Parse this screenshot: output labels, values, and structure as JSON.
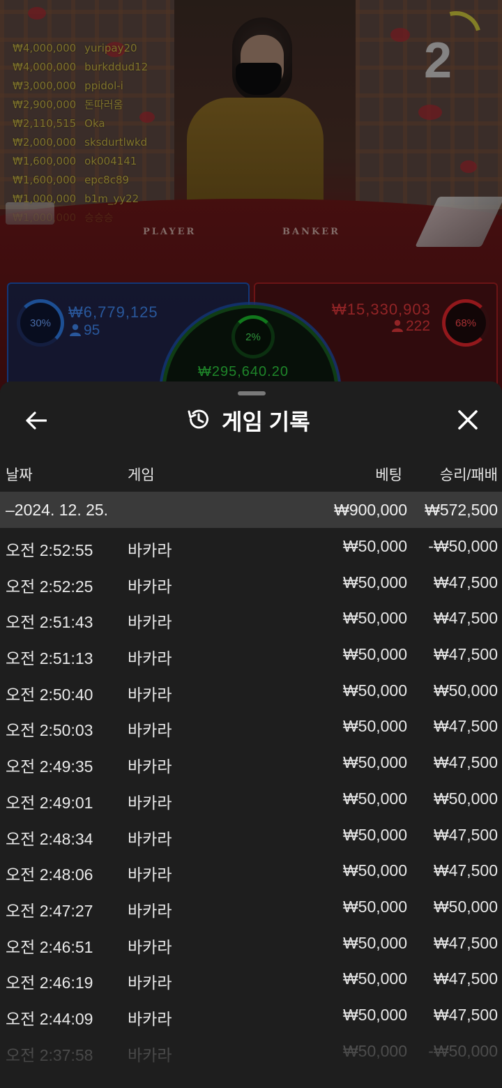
{
  "game_view": {
    "round_number": "2",
    "felt_labels": {
      "player": "PLAYER",
      "banker": "BANKER"
    },
    "top_bettors": [
      {
        "amount": "₩4,000,000",
        "user": "yuripay20"
      },
      {
        "amount": "₩4,000,000",
        "user": "burkddud12"
      },
      {
        "amount": "₩3,000,000",
        "user": "ppidol-i"
      },
      {
        "amount": "₩2,900,000",
        "user": "돈따러옴"
      },
      {
        "amount": "₩2,110,515",
        "user": "Oka"
      },
      {
        "amount": "₩2,000,000",
        "user": "sksdurtlwkd"
      },
      {
        "amount": "₩1,600,000",
        "user": "ok004141"
      },
      {
        "amount": "₩1,600,000",
        "user": "epc8c89"
      },
      {
        "amount": "₩1,000,000",
        "user": "b1m_yy22"
      },
      {
        "amount": "₩1,000,000",
        "user": "승승승"
      }
    ],
    "player": {
      "percent": "30%",
      "amount": "₩6,779,125",
      "players": "95",
      "color": "#2d7ae3"
    },
    "banker": {
      "percent": "68%",
      "amount": "₩15,330,903",
      "players": "222",
      "color": "#e2262b"
    },
    "tie": {
      "percent": "2%",
      "amount": "₩295,640.20",
      "color": "#1bb82b"
    }
  },
  "history": {
    "title": "게임 기록",
    "icons": {
      "back": "arrow-left-icon",
      "history": "history-icon",
      "close": "close-icon"
    },
    "columns": {
      "date": "날짜",
      "game": "게임",
      "bet": "베팅",
      "result": "승리/패배"
    },
    "summary": {
      "date": "–2024. 12. 25.",
      "bet": "₩900,000",
      "result": "₩572,500"
    },
    "rows": [
      {
        "time": "오전 2:52:55",
        "game": "바카라",
        "bet": "₩50,000",
        "result": "-₩50,000"
      },
      {
        "time": "오전 2:52:25",
        "game": "바카라",
        "bet": "₩50,000",
        "result": "₩47,500"
      },
      {
        "time": "오전 2:51:43",
        "game": "바카라",
        "bet": "₩50,000",
        "result": "₩47,500"
      },
      {
        "time": "오전 2:51:13",
        "game": "바카라",
        "bet": "₩50,000",
        "result": "₩47,500"
      },
      {
        "time": "오전 2:50:40",
        "game": "바카라",
        "bet": "₩50,000",
        "result": "₩50,000"
      },
      {
        "time": "오전 2:50:03",
        "game": "바카라",
        "bet": "₩50,000",
        "result": "₩47,500"
      },
      {
        "time": "오전 2:49:35",
        "game": "바카라",
        "bet": "₩50,000",
        "result": "₩47,500"
      },
      {
        "time": "오전 2:49:01",
        "game": "바카라",
        "bet": "₩50,000",
        "result": "₩50,000"
      },
      {
        "time": "오전 2:48:34",
        "game": "바카라",
        "bet": "₩50,000",
        "result": "₩47,500"
      },
      {
        "time": "오전 2:48:06",
        "game": "바카라",
        "bet": "₩50,000",
        "result": "₩47,500"
      },
      {
        "time": "오전 2:47:27",
        "game": "바카라",
        "bet": "₩50,000",
        "result": "₩50,000"
      },
      {
        "time": "오전 2:46:51",
        "game": "바카라",
        "bet": "₩50,000",
        "result": "₩47,500"
      },
      {
        "time": "오전 2:46:19",
        "game": "바카라",
        "bet": "₩50,000",
        "result": "₩47,500"
      },
      {
        "time": "오전 2:44:09",
        "game": "바카라",
        "bet": "₩50,000",
        "result": "₩47,500"
      },
      {
        "time": "오전 2:37:58",
        "game": "바카라",
        "bet": "₩50,000",
        "result": "-₩50,000"
      }
    ]
  }
}
